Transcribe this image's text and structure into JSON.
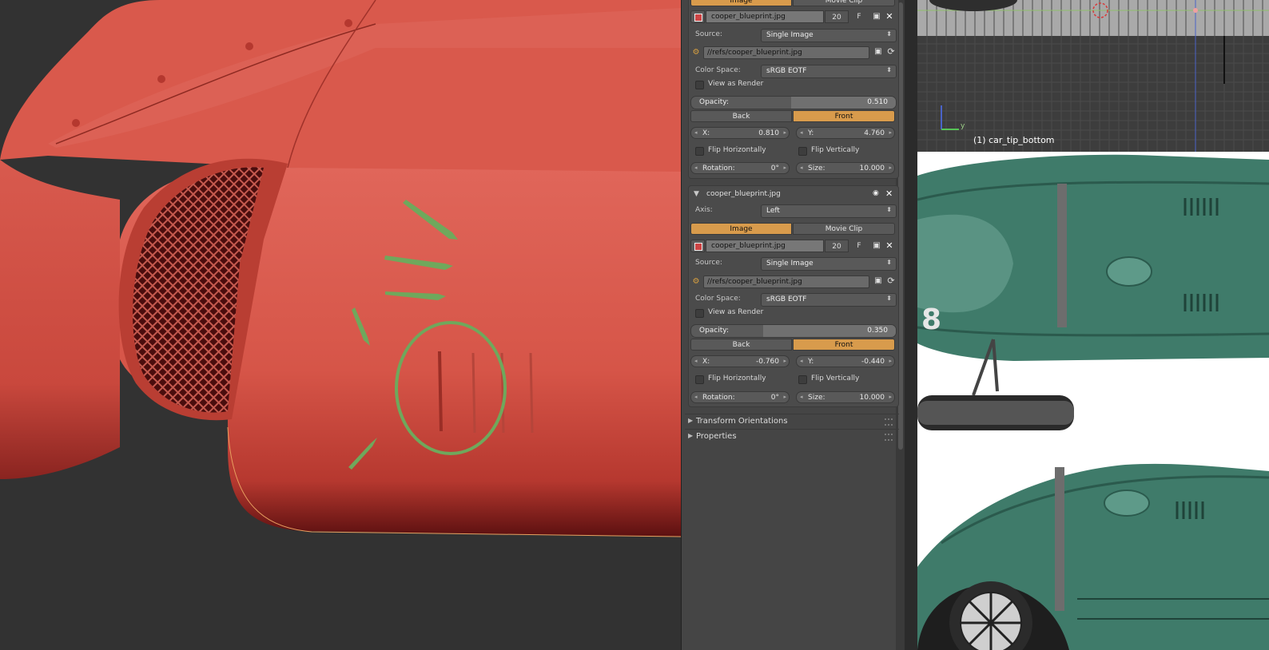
{
  "top_panel": {
    "tabs": [
      "Image",
      "Movie Clip"
    ],
    "active_tab": "Image",
    "image_name": "cooper_blueprint.jpg",
    "users": "20",
    "fake_user": "F",
    "source_label": "Source:",
    "source_value": "Single Image",
    "path": "//refs/cooper_blueprint.jpg",
    "color_space_label": "Color Space:",
    "color_space_value": "sRGB EOTF",
    "view_as_render": "View as Render",
    "opacity_label": "Opacity:",
    "opacity_value": "0.510",
    "opacity_fraction": 0.51,
    "back": "Back",
    "front": "Front",
    "x_label": "X:",
    "x_value": "0.810",
    "y_label": "Y:",
    "y_value": "4.760",
    "flip_h": "Flip Horizontally",
    "flip_v": "Flip Vertically",
    "rotation_label": "Rotation:",
    "rotation_value": "0°",
    "size_label": "Size:",
    "size_value": "10.000"
  },
  "second_panel": {
    "title": "cooper_blueprint.jpg",
    "axis_label": "Axis:",
    "axis_value": "Left",
    "tab_image": "Image",
    "tab_movie": "Movie Clip",
    "image_name": "cooper_blueprint.jpg",
    "users": "20",
    "fake_user": "F",
    "source_label": "Source:",
    "source_value": "Single Image",
    "path": "//refs/cooper_blueprint.jpg",
    "color_space_label": "Color Space:",
    "color_space_value": "sRGB EOTF",
    "view_as_render": "View as Render",
    "opacity_label": "Opacity:",
    "opacity_value": "0.350",
    "opacity_fraction": 0.35,
    "back": "Back",
    "front": "Front",
    "x_label": "X:",
    "x_value": "-0.760",
    "y_label": "Y:",
    "y_value": "-0.440",
    "flip_h": "Flip Horizontally",
    "flip_v": "Flip Vertically",
    "rotation_label": "Rotation:",
    "rotation_value": "0°",
    "size_label": "Size:",
    "size_value": "10.000"
  },
  "collapsed_panels": [
    "Transform Orientations",
    "Properties"
  ],
  "top_view": {
    "object_label": "(1) car_tip_bottom",
    "axis_y": "y"
  },
  "colors": {
    "accent_orange": "#d89b4c",
    "car_red": "#d65548",
    "annotation_green": "#6fa85c",
    "car_green": "#3f7b6a"
  },
  "icons": [
    "image-datablock-icon",
    "open-file-icon",
    "close-icon",
    "reload-icon",
    "eye-icon",
    "disclosure-triangle-icon"
  ]
}
